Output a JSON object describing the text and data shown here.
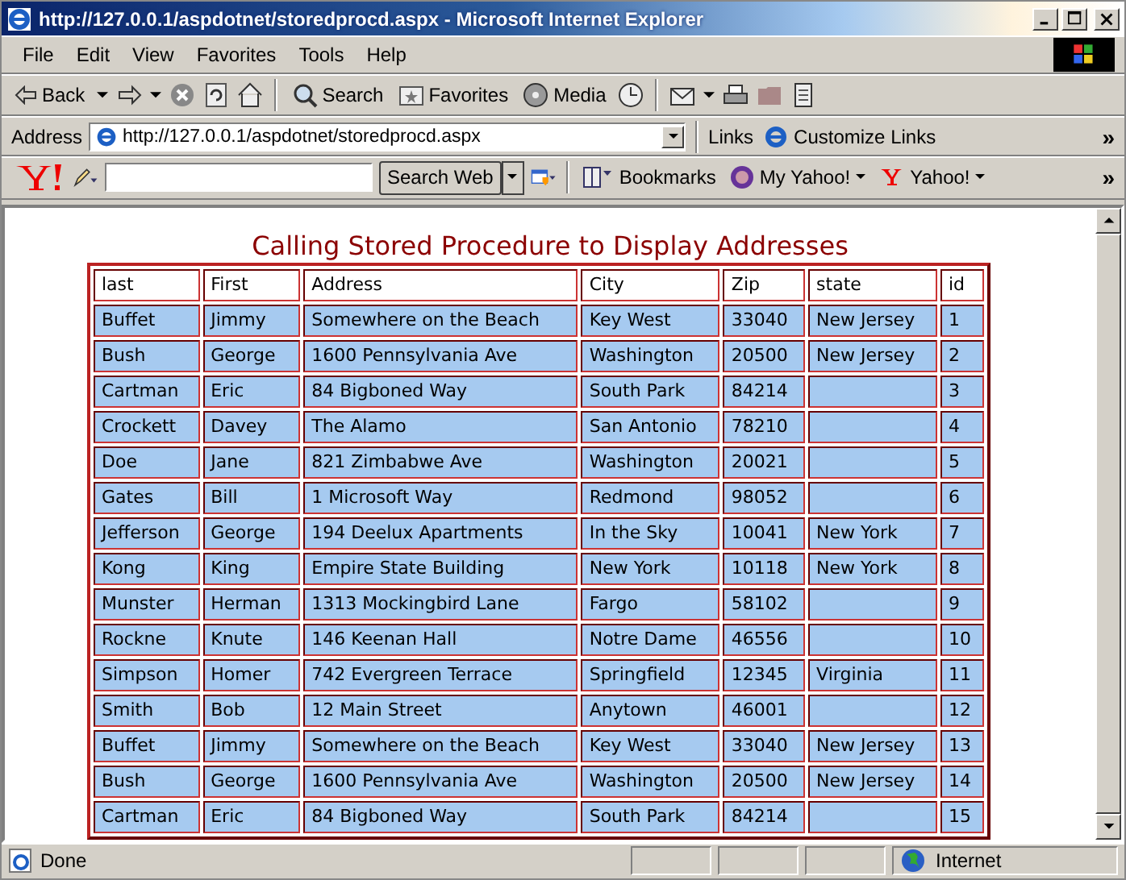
{
  "window": {
    "title": "http://127.0.0.1/aspdotnet/storedprocd.aspx - Microsoft Internet Explorer"
  },
  "menu": [
    {
      "label": "File"
    },
    {
      "label": "Edit"
    },
    {
      "label": "View"
    },
    {
      "label": "Favorites"
    },
    {
      "label": "Tools"
    },
    {
      "label": "Help"
    }
  ],
  "toolbar": {
    "back": "Back",
    "search": "Search",
    "favorites": "Favorites",
    "media": "Media"
  },
  "address": {
    "label": "Address",
    "value": "http://127.0.0.1/aspdotnet/storedprocd.aspx",
    "links": "Links",
    "customize": "Customize Links",
    "more": "»"
  },
  "yahoo_bar": {
    "search_button": "Search Web",
    "bookmarks": "Bookmarks",
    "my_yahoo": "My Yahoo!",
    "yahoo": "Yahoo!",
    "more": "»"
  },
  "page": {
    "heading": "Calling Stored Procedure to Display Addresses",
    "table": {
      "columns": [
        "last",
        "First",
        "Address",
        "City",
        "Zip",
        "state",
        "id"
      ],
      "rows": [
        [
          "Buffet",
          "Jimmy",
          "Somewhere on the Beach",
          "Key West",
          "33040",
          "New Jersey",
          "1"
        ],
        [
          "Bush",
          "George",
          "1600 Pennsylvania Ave",
          "Washington",
          "20500",
          "New Jersey",
          "2"
        ],
        [
          "Cartman",
          "Eric",
          "84 Bigboned Way",
          "South Park",
          "84214",
          "",
          "3"
        ],
        [
          "Crockett",
          "Davey",
          "The Alamo",
          "San Antonio",
          "78210",
          "",
          "4"
        ],
        [
          "Doe",
          "Jane",
          "821 Zimbabwe Ave",
          "Washington",
          "20021",
          "",
          "5"
        ],
        [
          "Gates",
          "Bill",
          "1 Microsoft Way",
          "Redmond",
          "98052",
          "",
          "6"
        ],
        [
          "Jefferson",
          "George",
          "194 Deelux Apartments",
          "In the Sky",
          "10041",
          "New York",
          "7"
        ],
        [
          "Kong",
          "King",
          "Empire State Building",
          "New York",
          "10118",
          "New York",
          "8"
        ],
        [
          "Munster",
          "Herman",
          "1313 Mockingbird Lane",
          "Fargo",
          "58102",
          "",
          "9"
        ],
        [
          "Rockne",
          "Knute",
          "146 Keenan Hall",
          "Notre Dame",
          "46556",
          "",
          "10"
        ],
        [
          "Simpson",
          "Homer",
          "742 Evergreen Terrace",
          "Springfield",
          "12345",
          "Virginia",
          "11"
        ],
        [
          "Smith",
          "Bob",
          "12 Main Street",
          "Anytown",
          "46001",
          "",
          "12"
        ],
        [
          "Buffet",
          "Jimmy",
          "Somewhere on the Beach",
          "Key West",
          "33040",
          "New Jersey",
          "13"
        ],
        [
          "Bush",
          "George",
          "1600 Pennsylvania Ave",
          "Washington",
          "20500",
          "New Jersey",
          "14"
        ],
        [
          "Cartman",
          "Eric",
          "84 Bigboned Way",
          "South Park",
          "84214",
          "",
          "15"
        ]
      ]
    }
  },
  "status_bar": {
    "text": "Done",
    "zone": "Internet"
  }
}
